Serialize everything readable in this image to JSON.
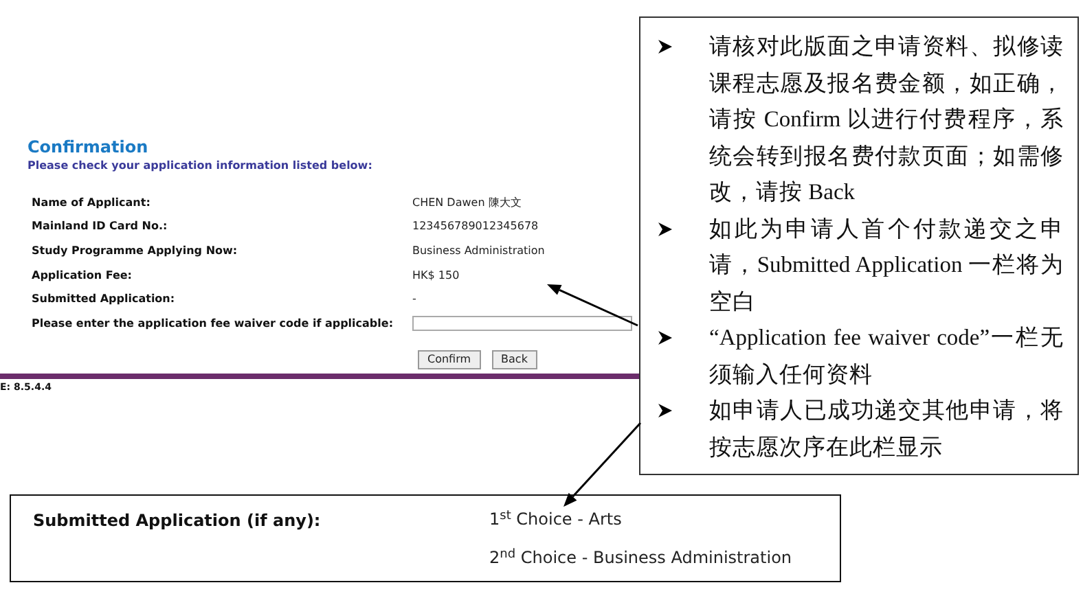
{
  "form": {
    "title": "Confirmation",
    "subtitle": "Please check your application information listed below:",
    "fields": [
      {
        "kind": "text",
        "label": "Name of Applicant:",
        "value": "CHEN Dawen 陳大文"
      },
      {
        "kind": "text",
        "label": "Mainland ID Card No.:",
        "value": "123456789012345678"
      },
      {
        "kind": "text",
        "label": "Study Programme Applying Now:",
        "value": "Business Administration"
      },
      {
        "kind": "text",
        "label": "Application Fee:",
        "value": "HK$ 150"
      },
      {
        "kind": "text",
        "label": "Submitted Application:",
        "value": "-"
      },
      {
        "kind": "input",
        "label": "Please enter the application fee waiver code if applicable:"
      }
    ],
    "buttons": [
      "Confirm",
      "Back"
    ],
    "footer": "E: 8.5.4.4"
  },
  "notes": [
    "请核对此版面之申请资料、拟修读课程志愿及报名费金额，如正确，请按 Confirm 以进行付费程序，系统会转到报名费付款页面；如需修改，请按 Back",
    "如此为申请人首个付款递交之申请，Submitted Application 一栏将为空白",
    "“Application fee waiver code”一栏无须输入任何资料",
    "如申请人已成功递交其他申请，将按志愿次序在此栏显示"
  ],
  "submitted": {
    "label": "Submitted Application (if any):",
    "choices": [
      "1$^{st}$ Choice - Arts",
      "2$^{nd}$ Choice - Business Administration"
    ]
  }
}
